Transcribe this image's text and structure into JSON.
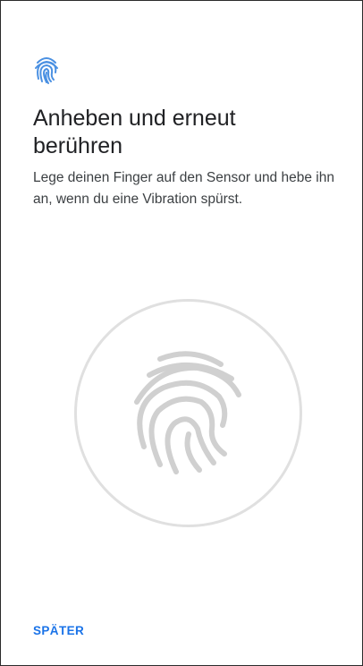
{
  "header": {
    "icon": "fingerprint-icon",
    "icon_color": "#4a90e2"
  },
  "main": {
    "title": "Anheben und erneut berühren",
    "description": "Lege deinen Finger auf den Sensor und hebe ihn an, wenn du eine Vibration spürst."
  },
  "sensor": {
    "icon": "fingerprint-icon",
    "ring_color": "#e0e0e0",
    "fingerprint_color": "#d0d0d0"
  },
  "footer": {
    "later_label": "SPÄTER",
    "accent_color": "#1a73e8"
  }
}
